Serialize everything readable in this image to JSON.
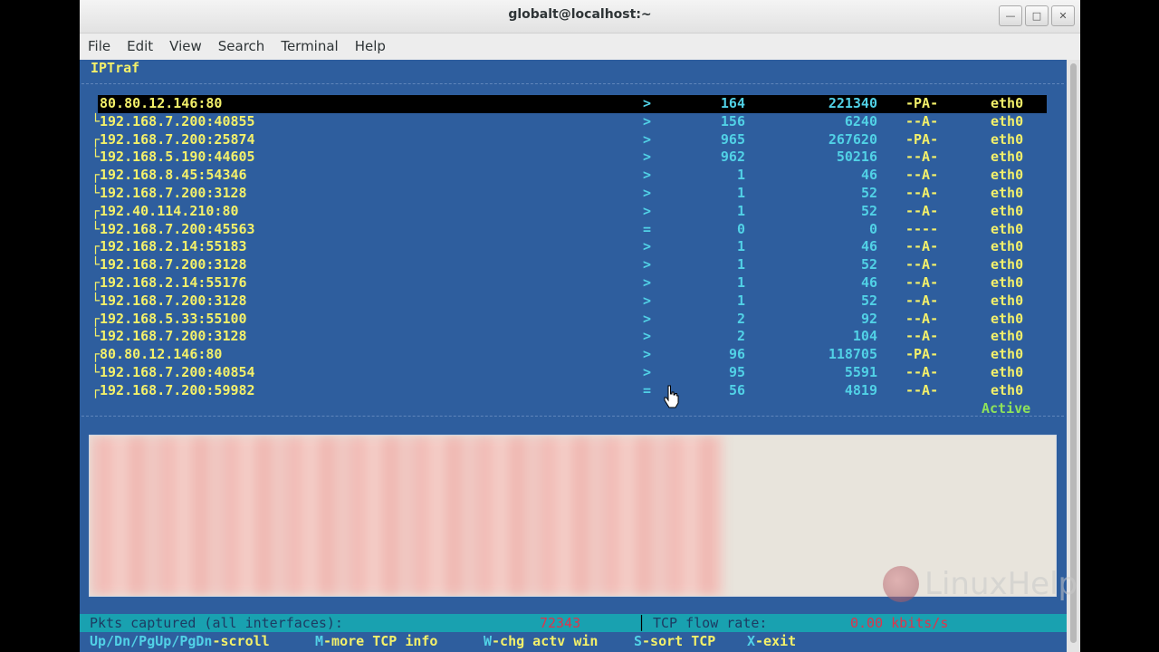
{
  "window": {
    "title": "globalt@localhost:~",
    "minimize_icon": "minimize-icon",
    "maximize_icon": "maximize-icon",
    "close_icon": "close-icon"
  },
  "menu": [
    "File",
    "Edit",
    "View",
    "Search",
    "Terminal",
    "Help"
  ],
  "iptraf": {
    "title": "IPTraf",
    "status": "Active",
    "connections": [
      {
        "addr": "80.80.12.146:80",
        "dir": ">",
        "pkts": "164",
        "bytes": "221340",
        "flags": "-PA-",
        "iface": "eth0",
        "bracket": "",
        "selected": true
      },
      {
        "addr": "192.168.7.200:40855",
        "dir": ">",
        "pkts": "156",
        "bytes": "6240",
        "flags": "--A-",
        "iface": "eth0",
        "bracket": "└"
      },
      {
        "addr": "192.168.7.200:25874",
        "dir": ">",
        "pkts": "965",
        "bytes": "267620",
        "flags": "-PA-",
        "iface": "eth0",
        "bracket": "┌"
      },
      {
        "addr": "192.168.5.190:44605",
        "dir": ">",
        "pkts": "962",
        "bytes": "50216",
        "flags": "--A-",
        "iface": "eth0",
        "bracket": "└"
      },
      {
        "addr": "192.168.8.45:54346",
        "dir": ">",
        "pkts": "1",
        "bytes": "46",
        "flags": "--A-",
        "iface": "eth0",
        "bracket": "┌"
      },
      {
        "addr": "192.168.7.200:3128",
        "dir": ">",
        "pkts": "1",
        "bytes": "52",
        "flags": "--A-",
        "iface": "eth0",
        "bracket": "└"
      },
      {
        "addr": "192.40.114.210:80",
        "dir": ">",
        "pkts": "1",
        "bytes": "52",
        "flags": "--A-",
        "iface": "eth0",
        "bracket": "┌"
      },
      {
        "addr": "192.168.7.200:45563",
        "dir": "=",
        "pkts": "0",
        "bytes": "0",
        "flags": "----",
        "iface": "eth0",
        "bracket": "└"
      },
      {
        "addr": "192.168.2.14:55183",
        "dir": ">",
        "pkts": "1",
        "bytes": "46",
        "flags": "--A-",
        "iface": "eth0",
        "bracket": "┌"
      },
      {
        "addr": "192.168.7.200:3128",
        "dir": ">",
        "pkts": "1",
        "bytes": "52",
        "flags": "--A-",
        "iface": "eth0",
        "bracket": "└"
      },
      {
        "addr": "192.168.2.14:55176",
        "dir": ">",
        "pkts": "1",
        "bytes": "46",
        "flags": "--A-",
        "iface": "eth0",
        "bracket": "┌"
      },
      {
        "addr": "192.168.7.200:3128",
        "dir": ">",
        "pkts": "1",
        "bytes": "52",
        "flags": "--A-",
        "iface": "eth0",
        "bracket": "└"
      },
      {
        "addr": "192.168.5.33:55100",
        "dir": ">",
        "pkts": "2",
        "bytes": "92",
        "flags": "--A-",
        "iface": "eth0",
        "bracket": "┌"
      },
      {
        "addr": "192.168.7.200:3128",
        "dir": ">",
        "pkts": "2",
        "bytes": "104",
        "flags": "--A-",
        "iface": "eth0",
        "bracket": "└"
      },
      {
        "addr": "80.80.12.146:80",
        "dir": ">",
        "pkts": "96",
        "bytes": "118705",
        "flags": "-PA-",
        "iface": "eth0",
        "bracket": "┌"
      },
      {
        "addr": "192.168.7.200:40854",
        "dir": ">",
        "pkts": "95",
        "bytes": "5591",
        "flags": "--A-",
        "iface": "eth0",
        "bracket": "└"
      },
      {
        "addr": "192.168.7.200:59982",
        "dir": "=",
        "pkts": "56",
        "bytes": "4819",
        "flags": "--A-",
        "iface": "eth0",
        "bracket": "┌"
      }
    ],
    "stats": {
      "pkts_label": "Pkts captured (all interfaces):",
      "pkts_value": "72343",
      "separator": "│",
      "flow_label": "TCP flow rate:",
      "flow_value": "0.00 kbits/s"
    },
    "keys": [
      {
        "key": "Up/Dn/PgUp/PgDn",
        "label": "-scroll"
      },
      {
        "key": "M",
        "label": "-more TCP info"
      },
      {
        "key": "W",
        "label": "-chg actv win"
      },
      {
        "key": "S",
        "label": "-sort TCP"
      },
      {
        "key": "X",
        "label": "-exit"
      }
    ]
  },
  "watermark": {
    "text": "LinuxHelp"
  },
  "colors": {
    "terminal_bg": "#2e5e9e",
    "yellow_text": "#f3f06a",
    "cyan_text": "#51d1e6",
    "status_bar": "#19a1b0",
    "active_green": "#8fe35a"
  },
  "icons": {
    "cursor": "hand-pointer-icon",
    "logo": "linuxhelp-logo-icon"
  }
}
